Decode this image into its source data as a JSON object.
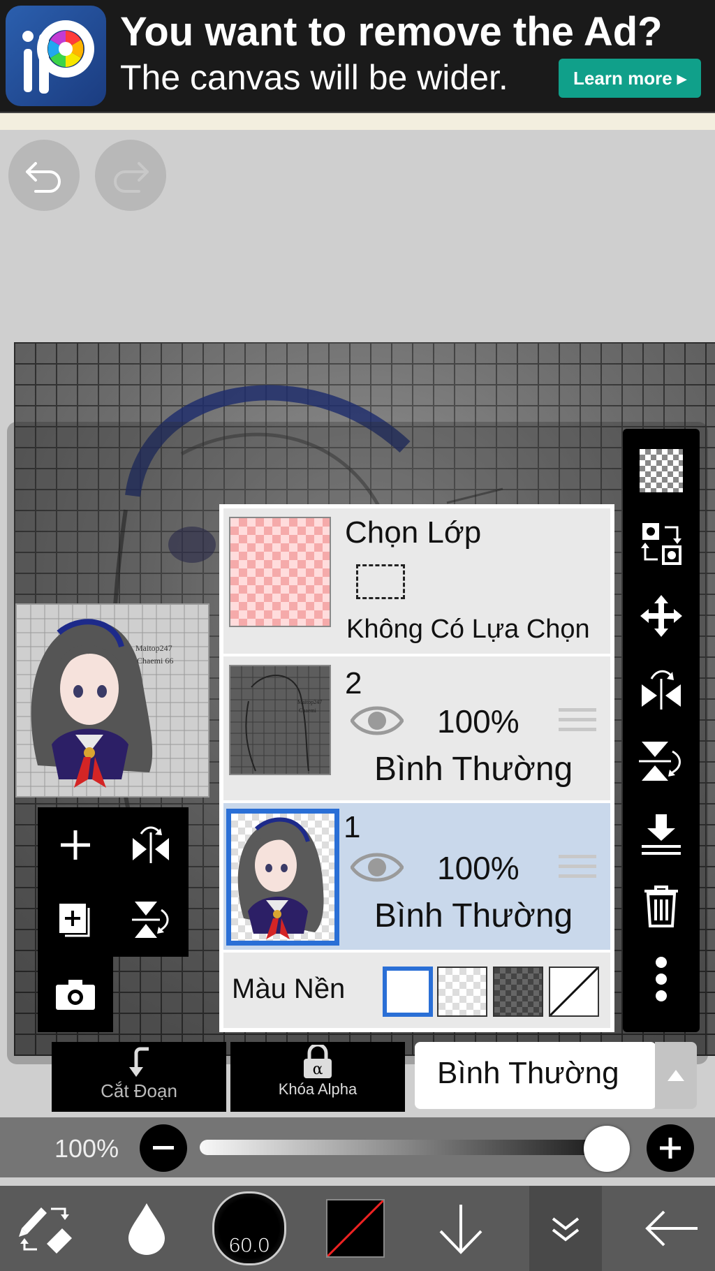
{
  "ad": {
    "headline": "You want to remove the Ad?",
    "subline": "The canvas will be wider.",
    "cta": "Learn more ▸"
  },
  "layers_panel": {
    "selection_layer": {
      "title": "Chọn Lớp",
      "status": "Không Có Lựa Chọn"
    },
    "layers": [
      {
        "name": "2",
        "opacity": "100%",
        "blend_mode": "Bình Thường",
        "selected": false
      },
      {
        "name": "1",
        "opacity": "100%",
        "blend_mode": "Bình Thường",
        "selected": true
      }
    ],
    "background_color_label": "Màu Nền"
  },
  "bottom_controls": {
    "clipping_label": "Cắt Đoạn",
    "alpha_lock_label": "Khóa Alpha",
    "blend_mode": "Bình Thường",
    "opacity_label": "100%",
    "opacity_value": 1.0
  },
  "toolbar": {
    "brush_size": "60.0"
  },
  "colors": {
    "selected_layer": "#c9d8eb",
    "selected_border": "#2a6fd6",
    "ad_cta": "#10a08a"
  },
  "thumbnail_texts": {
    "preview_note_1": "Maitop247",
    "preview_note_2": "Chaemi 66",
    "layer2_note_1": "Maitop247",
    "layer2_note_2": "Chaemi"
  }
}
